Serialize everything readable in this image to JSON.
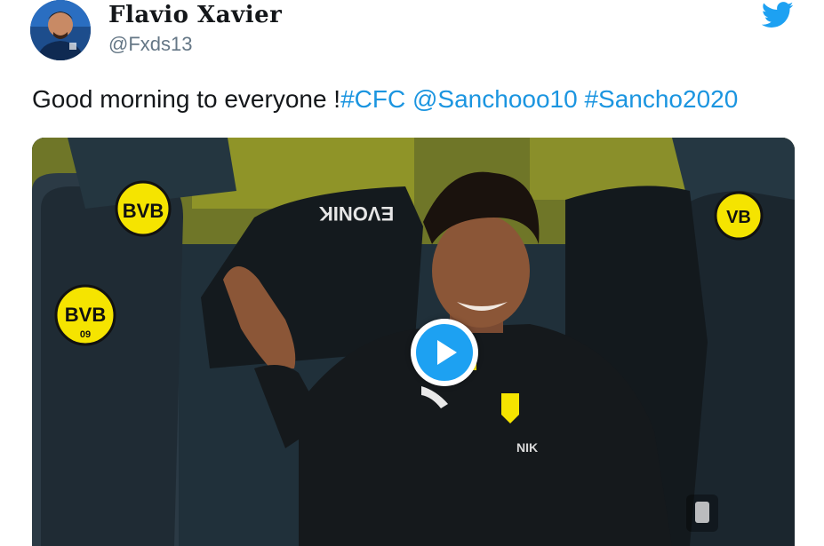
{
  "tweet": {
    "display_name": "Flavio Xavier",
    "handle": "@Fxds13",
    "text_plain": "Good morning to everyone !",
    "links": [
      "#CFC",
      "@Sanchooo10",
      "#Sancho2020"
    ]
  },
  "icons": {
    "brand": "twitter-bird-icon",
    "media_control": "play-icon"
  },
  "media": {
    "type": "video",
    "bench_badge_text": "BVB",
    "bench_badge_year": "09",
    "jacket_brand": "EVONIK"
  },
  "colors": {
    "link": "#1b95e0",
    "twitter_blue": "#1da1f2",
    "handle_gray": "#657786",
    "bvb_yellow": "#f5e400"
  }
}
